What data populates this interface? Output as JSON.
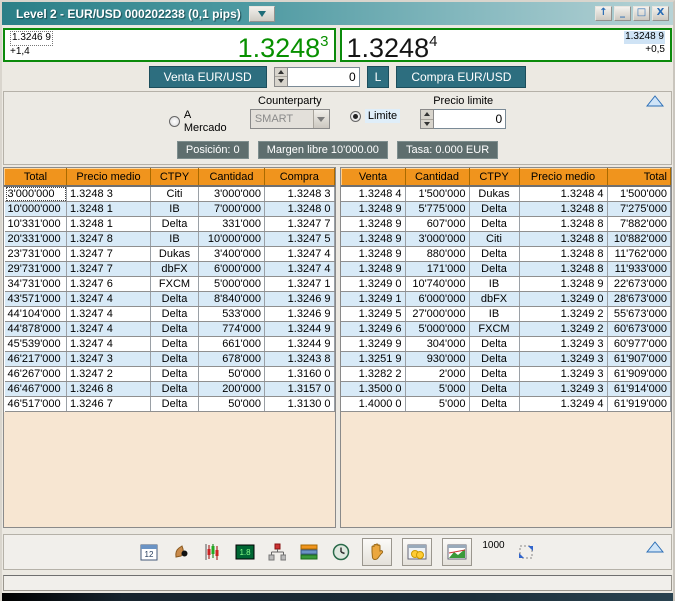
{
  "window": {
    "title": "Level 2 - EUR/USD 000202238 (0,1 pips)",
    "controls": {
      "shade": "↑",
      "minimize": "_",
      "maximize": "□",
      "close": "X"
    }
  },
  "prices": {
    "bid": {
      "ref_price": "1.3246 9",
      "change": "+1,4",
      "big": "1.3248",
      "pip": "3"
    },
    "ask": {
      "big": "1.3248",
      "pip": "4",
      "ref_price": "1.3248 9",
      "change": "+0,5"
    }
  },
  "order_entry": {
    "sell_button": "Venta EUR/USD",
    "quantity": "0",
    "lot_button": "L",
    "buy_button": "Compra EUR/USD"
  },
  "order_params": {
    "market_radio": "A Mercado",
    "counterparty_label": "Counterparty",
    "counterparty_value": "SMART",
    "limit_radio": "Limite",
    "limit_price_label": "Precio limite",
    "limit_price_value": "0"
  },
  "status_bar": {
    "position": "Posición: 0",
    "free_margin": "Margen libre 10'000.00",
    "rate": "Tasa: 0.000 EUR"
  },
  "bid_table": {
    "headers": [
      "Total",
      "Precio medio",
      "CTPY",
      "Cantidad",
      "Compra"
    ],
    "rows": [
      [
        "3'000'000",
        "1.3248 3",
        "Citi",
        "3'000'000",
        "1.3248 3"
      ],
      [
        "10'000'000",
        "1.3248 1",
        "IB",
        "7'000'000",
        "1.3248 0"
      ],
      [
        "10'331'000",
        "1.3248 1",
        "Delta",
        "331'000",
        "1.3247 7"
      ],
      [
        "20'331'000",
        "1.3247 8",
        "IB",
        "10'000'000",
        "1.3247 5"
      ],
      [
        "23'731'000",
        "1.3247 7",
        "Dukas",
        "3'400'000",
        "1.3247 4"
      ],
      [
        "29'731'000",
        "1.3247 7",
        "dbFX",
        "6'000'000",
        "1.3247 4"
      ],
      [
        "34'731'000",
        "1.3247 6",
        "FXCM",
        "5'000'000",
        "1.3247 1"
      ],
      [
        "43'571'000",
        "1.3247 4",
        "Delta",
        "8'840'000",
        "1.3246 9"
      ],
      [
        "44'104'000",
        "1.3247 4",
        "Delta",
        "533'000",
        "1.3246 9"
      ],
      [
        "44'878'000",
        "1.3247 4",
        "Delta",
        "774'000",
        "1.3244 9"
      ],
      [
        "45'539'000",
        "1.3247 4",
        "Delta",
        "661'000",
        "1.3244 9"
      ],
      [
        "46'217'000",
        "1.3247 3",
        "Delta",
        "678'000",
        "1.3243 8"
      ],
      [
        "46'267'000",
        "1.3247 2",
        "Delta",
        "50'000",
        "1.3160 0"
      ],
      [
        "46'467'000",
        "1.3246 8",
        "Delta",
        "200'000",
        "1.3157 0"
      ],
      [
        "46'517'000",
        "1.3246 7",
        "Delta",
        "50'000",
        "1.3130 0"
      ]
    ]
  },
  "ask_table": {
    "headers": [
      "Venta",
      "Cantidad",
      "CTPY",
      "Precio medio",
      "Total"
    ],
    "rows": [
      [
        "1.3248 4",
        "1'500'000",
        "Dukas",
        "1.3248 4",
        "1'500'000"
      ],
      [
        "1.3248 9",
        "5'775'000",
        "Delta",
        "1.3248 8",
        "7'275'000"
      ],
      [
        "1.3248 9",
        "607'000",
        "Delta",
        "1.3248 8",
        "7'882'000"
      ],
      [
        "1.3248 9",
        "3'000'000",
        "Citi",
        "1.3248 8",
        "10'882'000"
      ],
      [
        "1.3248 9",
        "880'000",
        "Delta",
        "1.3248 8",
        "11'762'000"
      ],
      [
        "1.3248 9",
        "171'000",
        "Delta",
        "1.3248 8",
        "11'933'000"
      ],
      [
        "1.3249 0",
        "10'740'000",
        "IB",
        "1.3248 9",
        "22'673'000"
      ],
      [
        "1.3249 1",
        "6'000'000",
        "dbFX",
        "1.3249 0",
        "28'673'000"
      ],
      [
        "1.3249 5",
        "27'000'000",
        "IB",
        "1.3249 2",
        "55'673'000"
      ],
      [
        "1.3249 6",
        "5'000'000",
        "FXCM",
        "1.3249 2",
        "60'673'000"
      ],
      [
        "1.3249 9",
        "304'000",
        "Delta",
        "1.3249 3",
        "60'977'000"
      ],
      [
        "1.3251 9",
        "930'000",
        "Delta",
        "1.3249 3",
        "61'907'000"
      ],
      [
        "1.3282 2",
        "2'000",
        "Delta",
        "1.3249 3",
        "61'909'000"
      ],
      [
        "1.3500 0",
        "5'000",
        "Delta",
        "1.3249 3",
        "61'914'000"
      ],
      [
        "1.4000 0",
        "5'000",
        "Delta",
        "1.3249 4",
        "61'919'000"
      ]
    ]
  },
  "toolbar": {
    "quantity_preset": "1000",
    "calendar_text": "12",
    "board_text": "1.8",
    "icons": [
      "calendar-icon",
      "pointer-icon",
      "candlestick-chart-icon",
      "price-board-icon",
      "org-chart-icon",
      "layers-icon",
      "clock-icon",
      "hand-icon",
      "coins-icon",
      "chart-window-icon",
      "expand-icon",
      "collapse-up-icon"
    ]
  },
  "colors": {
    "accent_teal": "#2d6e7f",
    "header_orange": "#f0941d",
    "bid_green": "#089000",
    "row_alt_blue": "#d8eaf7",
    "table_bg_peach": "#f7e6d2",
    "badge_slate": "#5e6e6e",
    "price_border_green": "#0b8a0b"
  }
}
